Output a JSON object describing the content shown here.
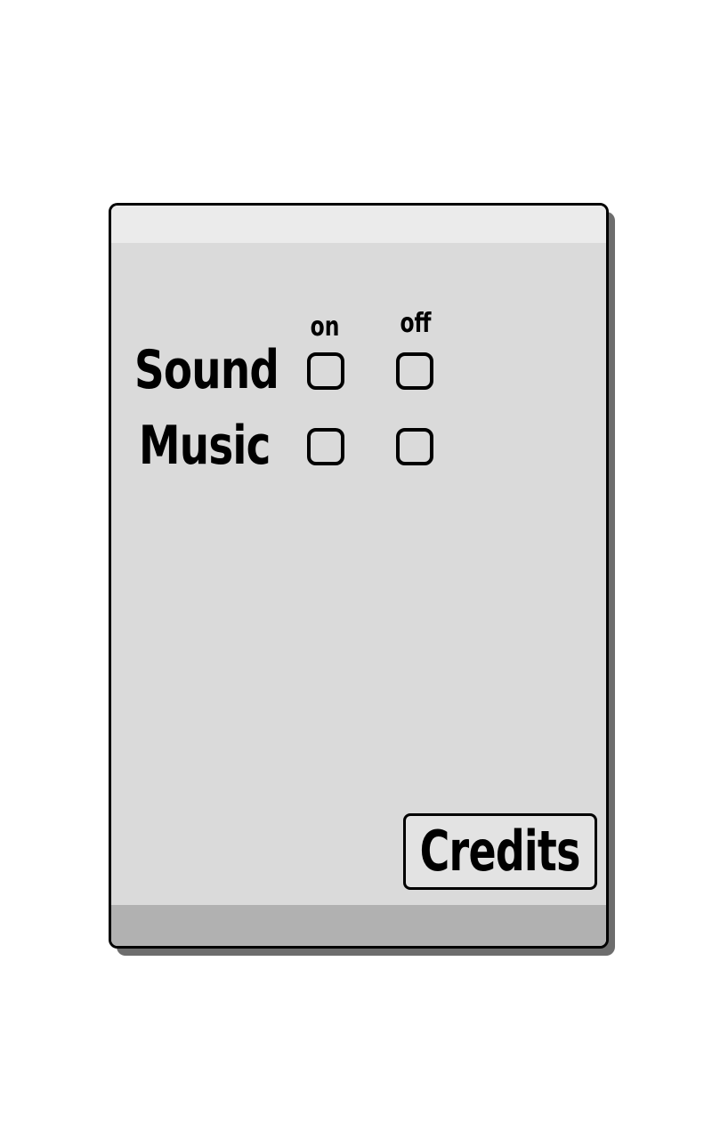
{
  "settings": {
    "columns": {
      "on_label": "on",
      "off_label": "off"
    },
    "rows": {
      "sound_label": "Sound",
      "music_label": "Music"
    },
    "credits_label": "Credits"
  },
  "colors": {
    "panel_fill": "#dadada",
    "panel_top_band": "#ebebeb",
    "panel_bottom_band": "#b1b1b1",
    "panel_shadow": "#6d6d6d",
    "outline": "#000000"
  }
}
